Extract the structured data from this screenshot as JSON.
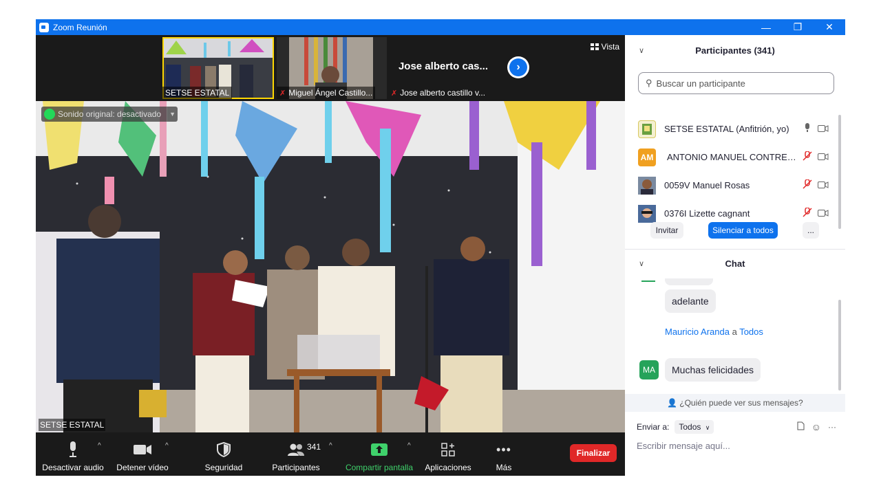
{
  "window": {
    "title": "Zoom Reunión",
    "minimize": "—",
    "restore": "❐",
    "close": "✕"
  },
  "strip": {
    "thumbs": [
      {
        "label": "SETSE ESTATAL",
        "muted": false
      },
      {
        "label": "Miguel Ángel Castillo...",
        "muted": true
      },
      {
        "label": "Jose alberto castillo v...",
        "muted": true
      }
    ],
    "big_name": "Jose alberto cas...",
    "vista_label": "Vista"
  },
  "main_video": {
    "original_audio": "Sonido original: desactivado",
    "speaker_name": "SETSE ESTATAL"
  },
  "toolbar": {
    "mute": "Desactivar audio",
    "video": "Detener vídeo",
    "security": "Seguridad",
    "participants": "Participantes",
    "participants_count": "341",
    "share": "Compartir pantalla",
    "apps": "Aplicaciones",
    "more": "Más",
    "end": "Finalizar"
  },
  "participants_panel": {
    "title": "Participantes (341)",
    "search_placeholder": "Buscar un participante",
    "list": [
      {
        "name": "SETSE ESTATAL (Anfitrión, yo)",
        "initials": "",
        "muted": false
      },
      {
        "name": "ANTONIO MANUEL CONTRER...",
        "initials": "AM",
        "muted": true
      },
      {
        "name": "0059V Manuel Rosas",
        "initials": "",
        "muted": true
      },
      {
        "name": "0376I Lizette cagnant",
        "initials": "",
        "muted": true
      }
    ],
    "invite": "Invitar",
    "mute_all": "Silenciar a todos",
    "more": "..."
  },
  "chat": {
    "title": "Chat",
    "messages": [
      {
        "text": "adelante"
      }
    ],
    "last_sender": "Mauricio Aranda",
    "to_word": "a",
    "recipient": "Todos",
    "last_initials": "MA",
    "last_text": "Muchas felicidades",
    "who_sees": "¿Quién puede ver sus mensajes?",
    "send_to_label": "Enviar a:",
    "send_to_value": "Todos",
    "input_placeholder": "Escribir mensaje aquí..."
  },
  "colors": {
    "accent": "#0e72ed",
    "end_red": "#e02828",
    "share_green": "#3fd16b",
    "am_avatar": "#f0a020",
    "ma_avatar": "#25a35a"
  }
}
